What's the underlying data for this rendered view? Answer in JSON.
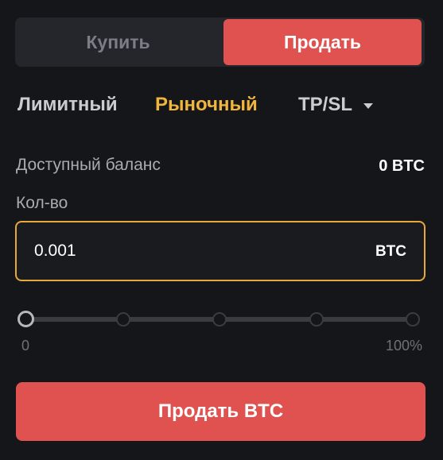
{
  "side_toggle": {
    "buy_label": "Купить",
    "sell_label": "Продать",
    "selected": "sell"
  },
  "order_tabs": {
    "limit_label": "Лимитный",
    "market_label": "Рыночный",
    "tpsl_label": "TP/SL",
    "selected": "market"
  },
  "balance": {
    "label": "Доступный баланс",
    "value": "0 BTC"
  },
  "quantity": {
    "label": "Кол-во",
    "value": "0.001",
    "unit": "BTC"
  },
  "slider": {
    "min_label": "0",
    "max_label": "100%",
    "value_percent": 0,
    "steps": [
      0,
      25,
      50,
      75,
      100
    ]
  },
  "submit": {
    "label": "Продать BTC"
  },
  "colors": {
    "sell_accent": "#e0524f",
    "active_tab": "#f0b53c",
    "input_focus_border": "#e8a93a",
    "background": "#151619"
  },
  "icons": {
    "tpsl_dropdown": "caret-down-icon"
  }
}
